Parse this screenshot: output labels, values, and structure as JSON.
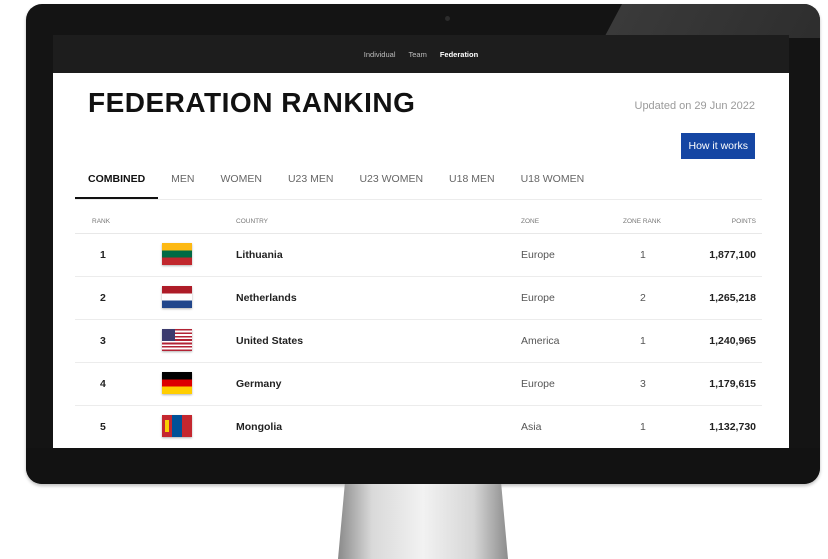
{
  "nav": {
    "items": [
      {
        "label": "Individual",
        "active": false
      },
      {
        "label": "Team",
        "active": false
      },
      {
        "label": "Federation",
        "active": true
      }
    ]
  },
  "page": {
    "title": "FEDERATION RANKING",
    "updated": "Updated on 29 Jun 2022",
    "how_it_works": "How it works"
  },
  "tabs": [
    {
      "label": "COMBINED",
      "active": true
    },
    {
      "label": "MEN",
      "active": false
    },
    {
      "label": "WOMEN",
      "active": false
    },
    {
      "label": "U23 MEN",
      "active": false
    },
    {
      "label": "U23 WOMEN",
      "active": false
    },
    {
      "label": "U18 MEN",
      "active": false
    },
    {
      "label": "U18 WOMEN",
      "active": false
    }
  ],
  "table": {
    "headers": {
      "rank": "RANK",
      "country": "COUNTRY",
      "zone": "ZONE",
      "zone_rank": "ZONE RANK",
      "points": "POINTS"
    },
    "rows": [
      {
        "rank": "1",
        "flag": "lithuania-flag",
        "country": "Lithuania",
        "zone": "Europe",
        "zone_rank": "1",
        "points": "1,877,100"
      },
      {
        "rank": "2",
        "flag": "netherlands-flag",
        "country": "Netherlands",
        "zone": "Europe",
        "zone_rank": "2",
        "points": "1,265,218"
      },
      {
        "rank": "3",
        "flag": "united-states-flag",
        "country": "United States",
        "zone": "America",
        "zone_rank": "1",
        "points": "1,240,965"
      },
      {
        "rank": "4",
        "flag": "germany-flag",
        "country": "Germany",
        "zone": "Europe",
        "zone_rank": "3",
        "points": "1,179,615"
      },
      {
        "rank": "5",
        "flag": "mongolia-flag",
        "country": "Mongolia",
        "zone": "Asia",
        "zone_rank": "1",
        "points": "1,132,730"
      }
    ]
  },
  "colors": {
    "accent": "#1546a3",
    "navbar": "#1d1d1d",
    "bezel": "#141414"
  }
}
